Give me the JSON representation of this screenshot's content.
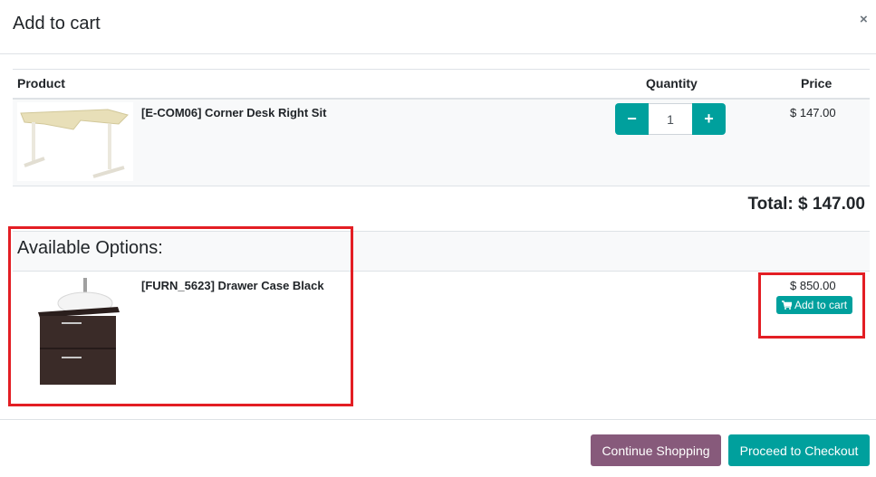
{
  "modal": {
    "title": "Add to cart",
    "close_icon": "×"
  },
  "table": {
    "headers": {
      "product": "Product",
      "quantity": "Quantity",
      "price": "Price"
    },
    "rows": [
      {
        "name": "[E-COM06] Corner Desk Right Sit",
        "quantity": "1",
        "price": "$ 147.00",
        "image": "corner-desk"
      }
    ],
    "qty_minus": "−",
    "qty_plus": "+"
  },
  "total": "Total: $ 147.00",
  "options": {
    "title": "Available Options:",
    "items": [
      {
        "name": "[FURN_5623] Drawer Case Black",
        "price": "$ 850.00",
        "add_label": "Add to cart",
        "add_icon": "cart-icon",
        "image": "drawer-case"
      }
    ]
  },
  "footer": {
    "continue_label": "Continue Shopping",
    "checkout_label": "Proceed to Checkout"
  },
  "colors": {
    "primary": "#00a09d",
    "secondary": "#875a7b",
    "highlight": "#e31e24"
  }
}
